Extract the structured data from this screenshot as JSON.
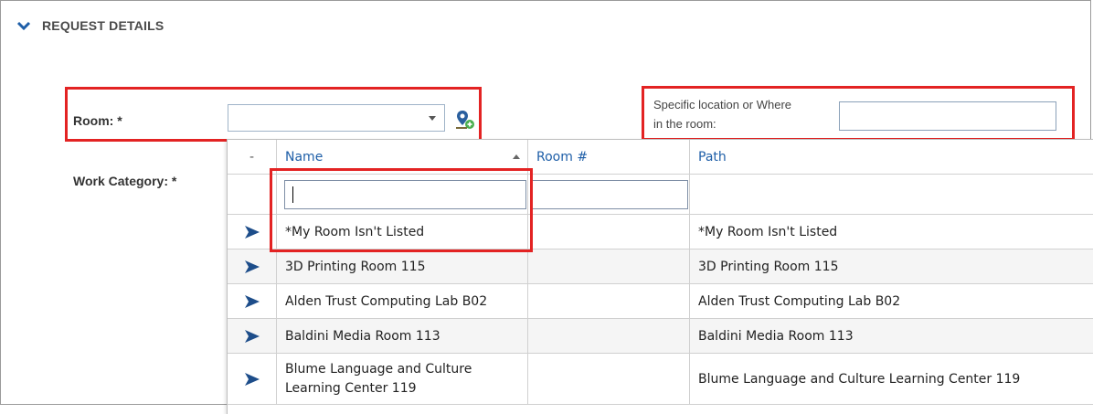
{
  "section": {
    "title": "REQUEST DETAILS",
    "icon": "chevron-down-icon"
  },
  "form": {
    "room_label": "Room: *",
    "room_value": "",
    "work_category_label": "Work Category: *",
    "specific_location_label_line1": "Specific location or Where",
    "specific_location_label_line2": "in the room:",
    "specific_location_value": ""
  },
  "dropdown": {
    "columns": {
      "select": "-",
      "name": "Name",
      "room_number": "Room #",
      "path": "Path"
    },
    "filters": {
      "name": "",
      "room_number": ""
    },
    "rows": [
      {
        "name": "*My Room Isn't Listed",
        "room_number": "",
        "path": "*My Room Isn't Listed"
      },
      {
        "name": "3D Printing Room 115",
        "room_number": "",
        "path": "3D Printing Room 115"
      },
      {
        "name": "Alden Trust Computing Lab B02",
        "room_number": "",
        "path": "Alden Trust Computing Lab B02"
      },
      {
        "name": "Baldini Media Room 113",
        "room_number": "",
        "path": "Baldini Media Room 113"
      },
      {
        "name_line1": "Blume Language and Culture",
        "name_line2": "Learning Center 119",
        "room_number": "",
        "path": "Blume Language and Culture Learning Center 119"
      }
    ]
  },
  "colors": {
    "accent": "#1f5fa8",
    "highlight_box": "#e32323",
    "arrow": "#1d4d8a"
  }
}
